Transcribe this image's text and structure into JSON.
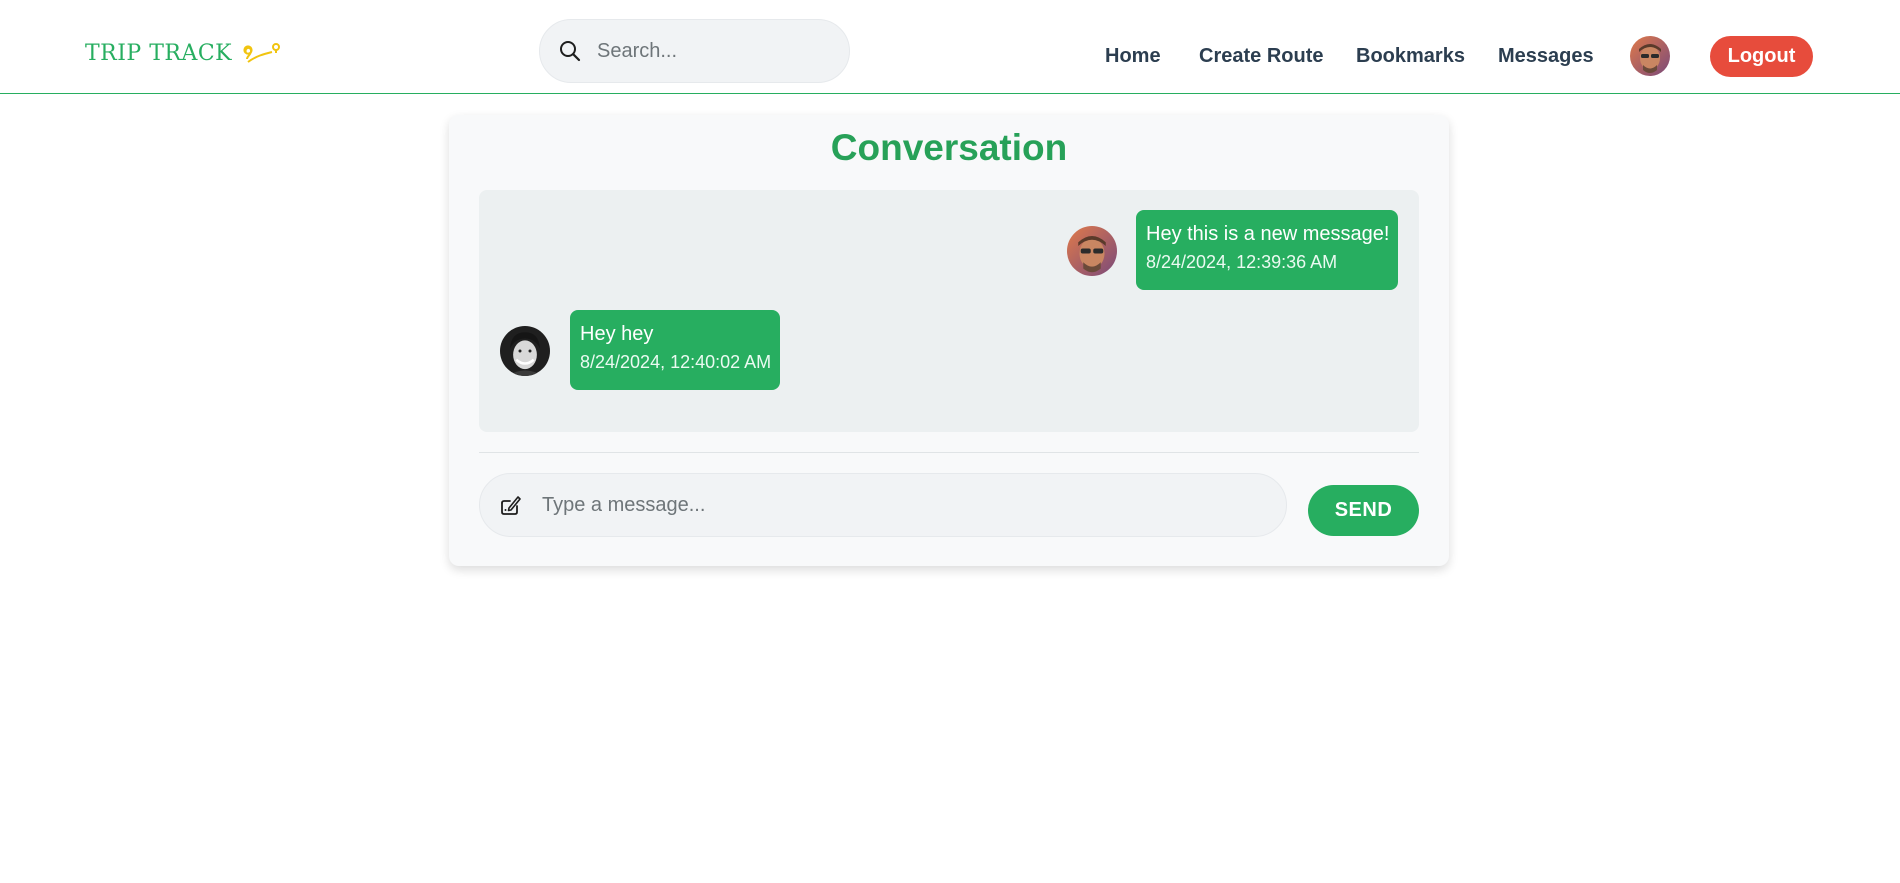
{
  "brand": {
    "name": "TRIP TRACK",
    "logo_icon": "route-pin-icon",
    "color": "#27ae60",
    "accent": "#f1c40f"
  },
  "search": {
    "placeholder": "Search...",
    "icon": "search-icon"
  },
  "nav": {
    "home": "Home",
    "create_route": "Create Route",
    "bookmarks": "Bookmarks",
    "messages": "Messages",
    "avatar": "user-avatar",
    "logout": "Logout",
    "logout_color": "#e74c3c"
  },
  "conversation": {
    "title": "Conversation",
    "messages": [
      {
        "side": "sent",
        "text": "Hey this is a new message!",
        "time": "8/24/2024, 12:39:36 AM"
      },
      {
        "side": "received",
        "text": "Hey hey",
        "time": "8/24/2024, 12:40:02 AM"
      }
    ],
    "composer": {
      "placeholder": "Type a message...",
      "icon": "write-icon",
      "send_label": "SEND"
    }
  }
}
